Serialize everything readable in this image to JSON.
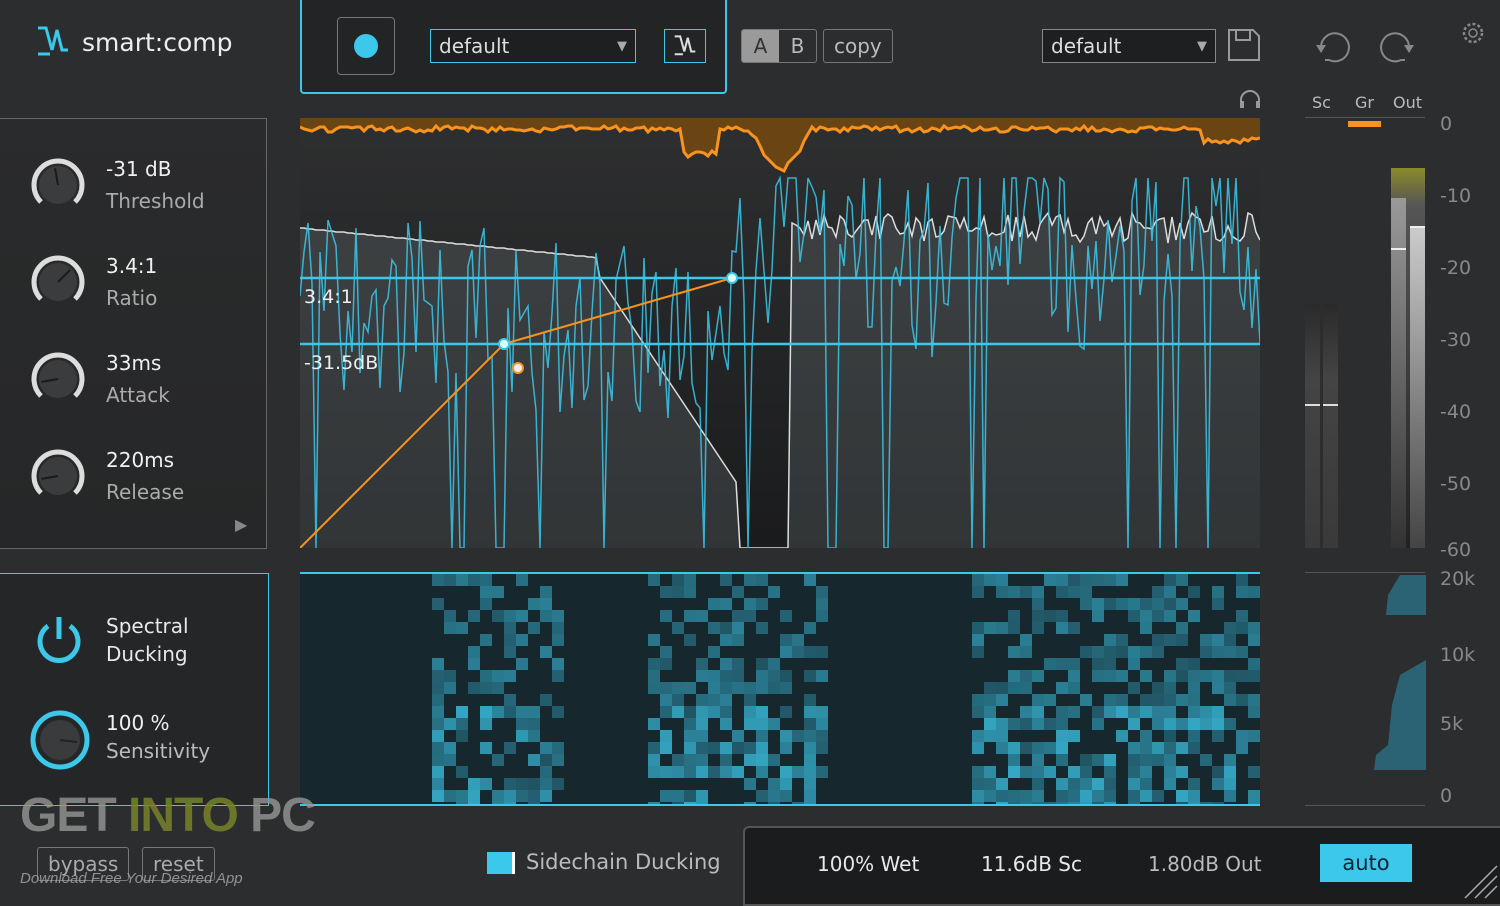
{
  "app": {
    "title": "smart:comp"
  },
  "header": {
    "preset_left": "default",
    "preset_right": "default",
    "a_label": "A",
    "b_label": "B",
    "copy_label": "copy"
  },
  "meters": {
    "sc": "Sc",
    "gr": "Gr",
    "out": "Out",
    "scale": [
      "0",
      "-10",
      "-20",
      "-30",
      "-40",
      "-50",
      "-60"
    ],
    "freq_scale": [
      "20k",
      "10k",
      "5k",
      "0"
    ]
  },
  "knobs": [
    {
      "value": "-31 dB",
      "label": "Threshold"
    },
    {
      "value": "3.4:1",
      "label": "Ratio"
    },
    {
      "value": "33ms",
      "label": "Attack"
    },
    {
      "value": "220ms",
      "label": "Release"
    }
  ],
  "spectral": {
    "label1": "Spectral",
    "label2": "Ducking",
    "sens_value": "100 %",
    "sens_label": "Sensitivity",
    "sensitivity_percent": 100
  },
  "graph": {
    "ratio_label": "3.4:1",
    "threshold_label": "-31.5dB"
  },
  "bottom": {
    "bypass": "bypass",
    "reset": "reset",
    "sidechain": "Sidechain Ducking",
    "wet": "100% Wet",
    "sc": "11.6dB Sc",
    "out": "1.80dB Out",
    "auto": "auto"
  },
  "watermark": {
    "text1": "GET",
    "text2": "INTO",
    "text3": "PC",
    "sub": "Download Free Your Desired App"
  },
  "colors": {
    "accent": "#3cc8ea",
    "orange": "#f7931e",
    "bg": "#2c2d2e"
  }
}
